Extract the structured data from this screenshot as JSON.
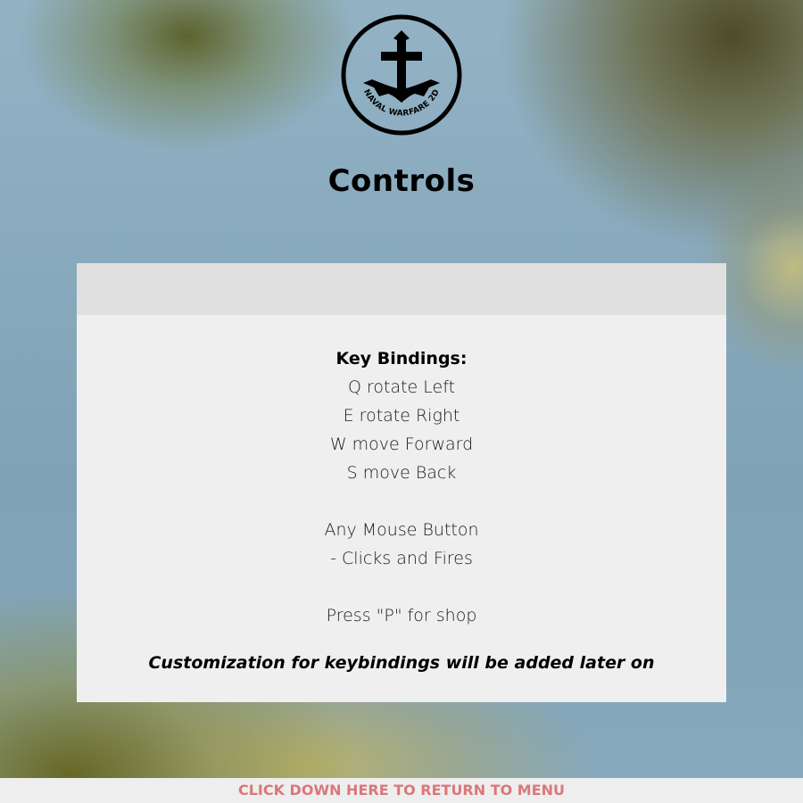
{
  "logo": {
    "icon": "anchor-icon",
    "text": "NAVAL WARFARE 2D"
  },
  "page": {
    "title": "Controls"
  },
  "panel": {
    "heading": "Key Bindings:",
    "bindings": [
      "Q rotate Left",
      "E rotate Right",
      "W move Forward",
      "S move Back"
    ],
    "mouse_line1": "Any Mouse Button",
    "mouse_line2": "- Clicks and Fires",
    "shop_line": "Press \"P\" for shop",
    "note": "Customization for keybindings will be added later on"
  },
  "footer": {
    "link_text": "CLICK DOWN HERE TO RETURN TO MENU"
  }
}
